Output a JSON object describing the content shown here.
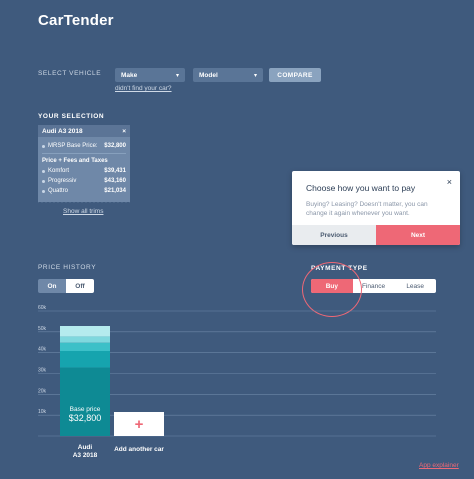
{
  "app": {
    "title": "CarTender"
  },
  "select_vehicle": {
    "label": "SELECT VEHICLE",
    "make": "Make",
    "model": "Model",
    "compare": "COMPARE",
    "not_found": "didn't find your car?"
  },
  "selection": {
    "label": "YOUR SELECTION",
    "car": "Audi A3 2018",
    "close": "×",
    "msrp_label": "MRSP Base Price:",
    "msrp_value": "$32,800",
    "fees_label": "Price + Fees and Taxes",
    "trims": [
      {
        "name": "Komfort",
        "price": "$39,431"
      },
      {
        "name": "Progressiv",
        "price": "$43,160"
      },
      {
        "name": "Quattro",
        "price": "$21,034"
      }
    ],
    "show_all": "Show all trims"
  },
  "dialog": {
    "title": "Choose how you want to pay",
    "close": "×",
    "body": "Buying? Leasing? Doesn't matter, you can change it again whenever you want.",
    "previous": "Previous",
    "next": "Next"
  },
  "price_history": {
    "label": "PRICE HISTORY",
    "on": "On",
    "off": "Off"
  },
  "payment": {
    "label": "PAYMENT TYPE",
    "options": [
      "Buy",
      "Finance",
      "Lease"
    ],
    "selected": "Buy"
  },
  "chart_data": {
    "type": "bar",
    "y_ticks": [
      "60k",
      "50k",
      "40k",
      "30k",
      "20k",
      "10k"
    ],
    "ylim": [
      0,
      60000
    ],
    "categories": [
      "Audi A3 2018"
    ],
    "stack": [
      {
        "value": 32800,
        "color": "#0e8a94"
      },
      {
        "value": 8000,
        "color": "#16a4ae"
      },
      {
        "value": 4000,
        "color": "#3cc0c8"
      },
      {
        "value": 3000,
        "color": "#7fd8de"
      },
      {
        "value": 5000,
        "color": "#b5ebee"
      }
    ],
    "base_label": "Base price",
    "base_value": "$32,800",
    "category_label_line1": "Audi",
    "category_label_line2": "A3 2018",
    "add_label": "Add another car",
    "add_symbol": "+"
  },
  "footer": {
    "app_explainer": "App explainer"
  },
  "colors": {
    "background": "#3f5a7d",
    "accent": "#ee6876",
    "teal": "#0e8a94"
  }
}
